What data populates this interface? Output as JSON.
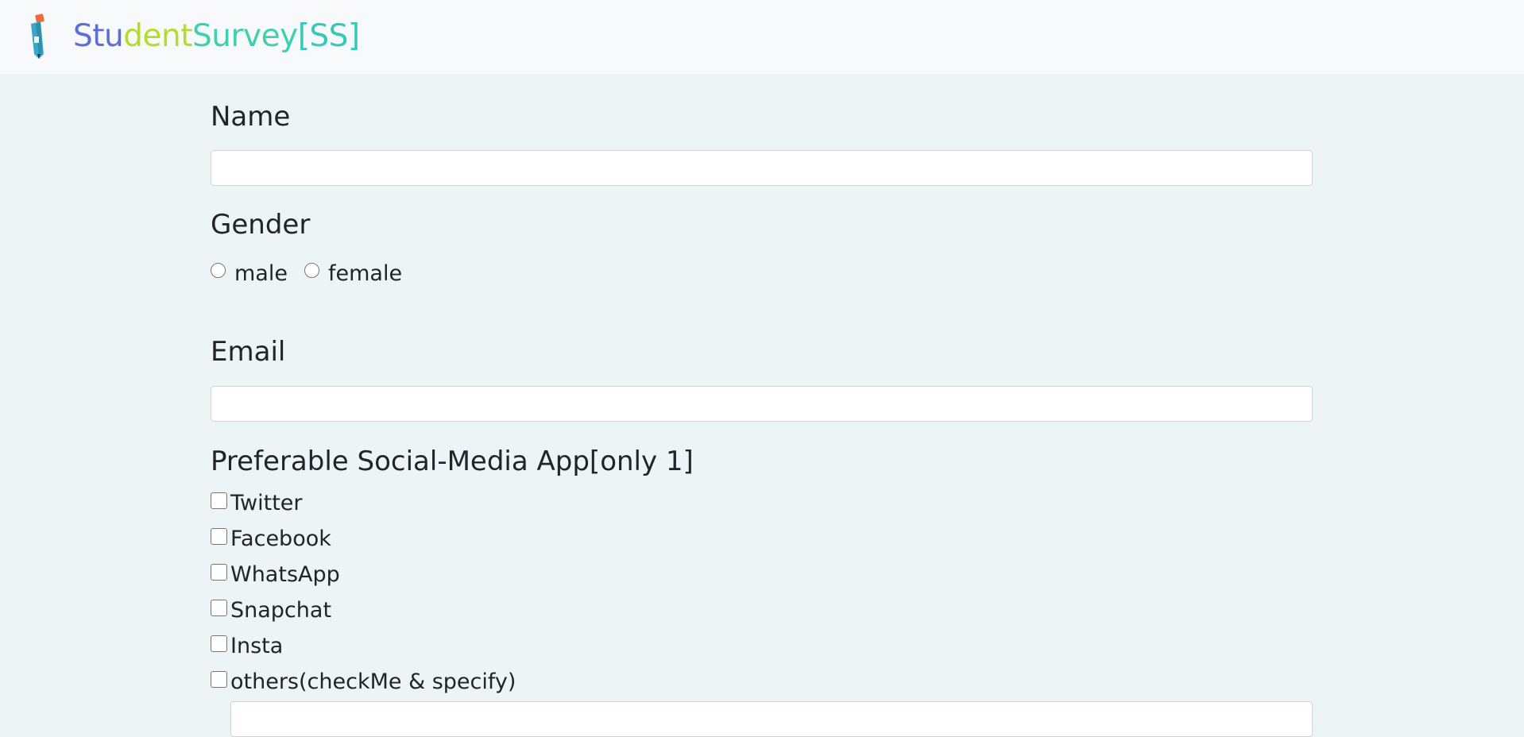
{
  "navbar": {
    "brand": {
      "parts": [
        {
          "text": "Stu",
          "color": "#5b6fd6"
        },
        {
          "text": "dent",
          "color": "#b3dd2a"
        },
        {
          "text": "Survey",
          "color": "#3fd0b0"
        },
        {
          "text": "[SS]",
          "color": "#36c9bb"
        }
      ]
    },
    "logo_icon": "pencil-logo-icon"
  },
  "form": {
    "name_label": "Name",
    "name_value": "",
    "gender_label": "Gender",
    "gender_options": [
      "male",
      "female"
    ],
    "email_label": "Email",
    "email_value": "",
    "social_label": "Preferable Social-Media App[only 1]",
    "social_options": [
      "Twitter",
      "Facebook",
      "WhatsApp",
      "Snapchat",
      "Insta",
      "others(checkMe & specify)"
    ],
    "other_value": ""
  },
  "colors": {
    "background": "#edf4f5",
    "navbar": "#f8f9fa"
  }
}
